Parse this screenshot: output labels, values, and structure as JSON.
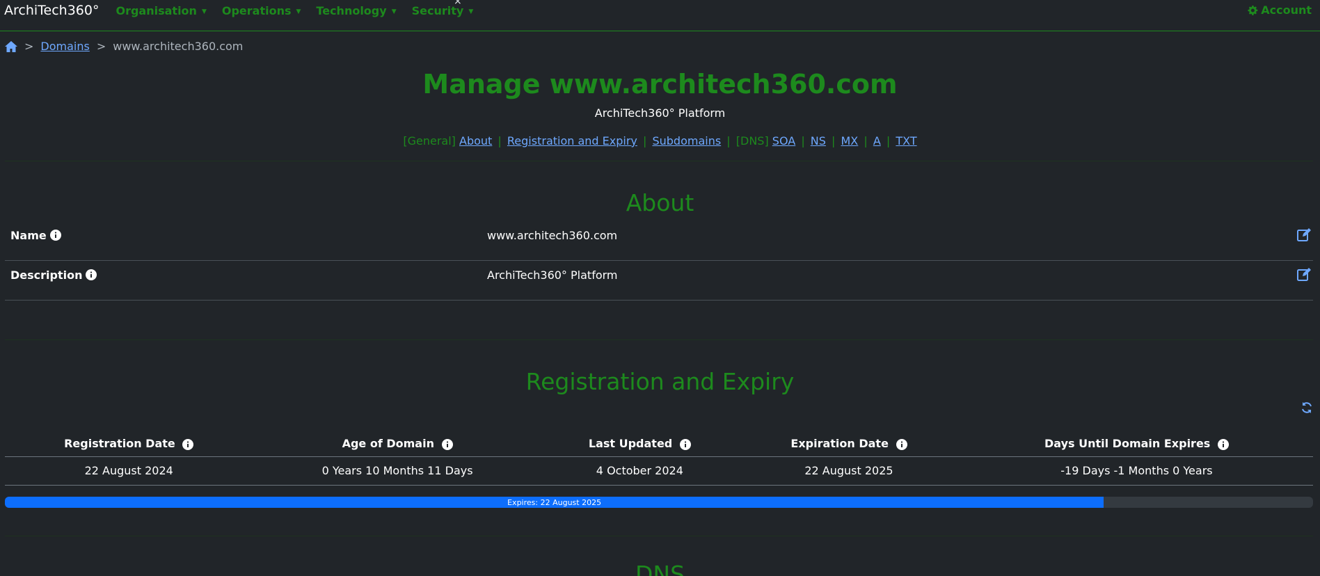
{
  "navbar": {
    "brand": "ArchiTech360°",
    "menus": [
      "Organisation",
      "Operations",
      "Technology",
      "Security"
    ],
    "account": "Account",
    "close_mark": "×"
  },
  "breadcrumb": {
    "home_icon": "home-icon",
    "sep": ">",
    "domains": "Domains",
    "current": "www.architech360.com"
  },
  "header": {
    "title": "Manage www.architech360.com",
    "subtitle": "ArchiTech360° Platform"
  },
  "section_links": {
    "general_tag": "[General]",
    "about": "About",
    "registration": "Registration and Expiry",
    "subdomains": "Subdomains",
    "dns_tag": "[DNS]",
    "soa": "SOA",
    "ns": "NS",
    "mx": "MX",
    "a": "A",
    "txt": "TXT",
    "bar": "|"
  },
  "about": {
    "heading": "About",
    "rows": [
      {
        "label": "Name",
        "value": "www.architech360.com"
      },
      {
        "label": "Description",
        "value": "ArchiTech360° Platform"
      }
    ]
  },
  "registration": {
    "heading": "Registration and Expiry",
    "columns": [
      "Registration Date",
      "Age of Domain",
      "Last Updated",
      "Expiration Date",
      "Days Until Domain Expires"
    ],
    "values": [
      "22 August 2024",
      "0 Years 10 Months 11 Days",
      "4 October 2024",
      "22 August 2025",
      "-19 Days -1 Months 0 Years"
    ],
    "progress_label": "Expires: 22 August 2025",
    "progress_fraction": 0.84
  },
  "dns": {
    "heading": "DNS"
  },
  "colors": {
    "accent_green": "#1d8a1d",
    "link_blue": "#6ea8fe",
    "progress_blue": "#0d6efd",
    "background": "#212529"
  }
}
